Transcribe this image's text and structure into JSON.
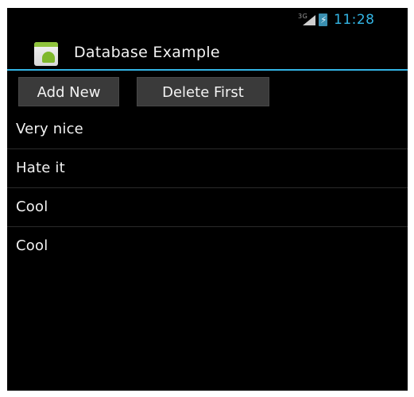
{
  "status_bar": {
    "network": "3G",
    "signal_icon": "signal-icon",
    "battery_icon": "battery-charging-icon",
    "time": "11:28",
    "time_color": "#33b5e5"
  },
  "action_bar": {
    "app_icon": "app-launcher-icon",
    "title": "Database Example",
    "accent_color": "#33b5e5"
  },
  "buttons": {
    "add_new": "Add New",
    "delete_first": "Delete First"
  },
  "list": {
    "items": [
      "Very nice",
      "Hate it",
      "Cool",
      "Cool"
    ]
  }
}
